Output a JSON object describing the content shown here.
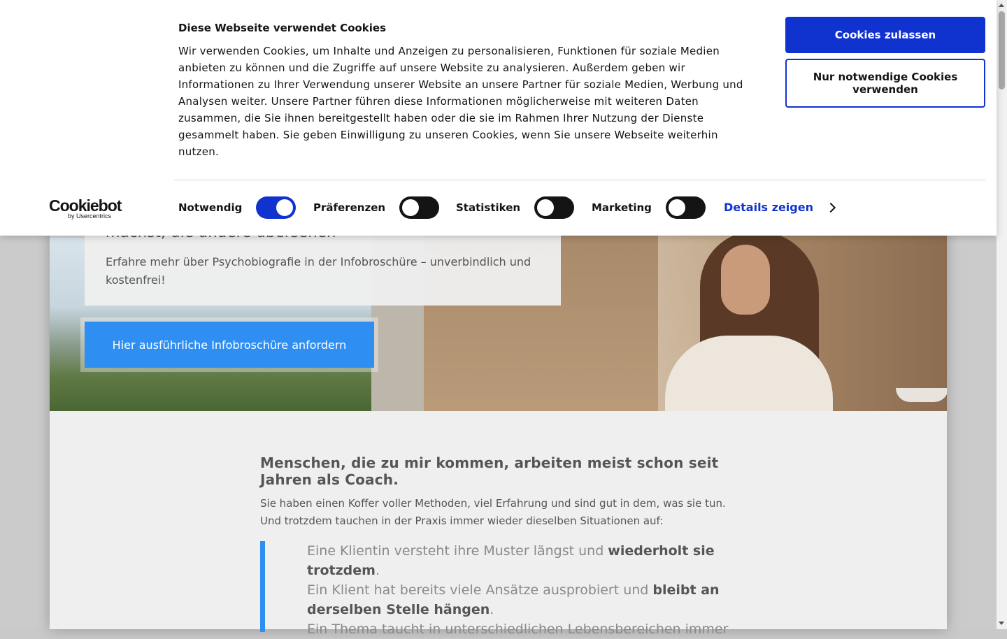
{
  "cookie_banner": {
    "title": "Diese Webseite verwendet Cookies",
    "text": "Wir verwenden Cookies, um Inhalte und Anzeigen zu personalisieren, Funktionen für soziale Medien anbieten zu können und die Zugriffe auf unsere Website zu analysieren. Außerdem geben wir Informationen zu Ihrer Verwendung unserer Website an unsere Partner für soziale Medien, Werbung und Analysen weiter. Unsere Partner führen diese Informationen möglicherweise mit weiteren Daten zusammen, die Sie ihnen bereitgestellt haben oder die sie im Rahmen Ihrer Nutzung der Dienste gesammelt haben. Sie geben Einwilligung zu unseren Cookies, wenn Sie unsere Webseite weiterhin nutzen.",
    "allow_button": "Cookies zulassen",
    "necessary_button": "Nur notwendige Cookies verwenden",
    "logo": {
      "main": "Cookiebot",
      "sub": "by Usercentrics"
    },
    "toggles": [
      {
        "label": "Notwendig",
        "on": true
      },
      {
        "label": "Präferenzen",
        "on": false
      },
      {
        "label": "Statistiken",
        "on": false
      },
      {
        "label": "Marketing",
        "on": false
      }
    ],
    "details_link": "Details zeigen",
    "accent_color": "#1032cf"
  },
  "hero": {
    "title_partial": "machst, die andere übersehen",
    "subtitle": "Erfahre mehr über Psychobiografie in der Infobroschüre – unverbindlich und kostenfrei!",
    "cta": "Hier ausführliche Infobroschüre anfordern",
    "cta_color": "#2f8ef2"
  },
  "section": {
    "title": "Menschen, die zu mir kommen, arbeiten meist schon seit Jahren als Coach.",
    "text": "Sie haben einen Koffer voller Methoden, viel Erfahrung und sind gut in dem, was sie tun. Und trotzdem tauchen in der Praxis immer wieder dieselben Situationen auf:",
    "quotes": [
      {
        "plain": "Eine Klientin versteht ihre Muster längst und ",
        "bold": "wiederholt sie trotzdem",
        "end": "."
      },
      {
        "plain": "Ein Klient hat bereits viele Ansätze ausprobiert und ",
        "bold": "bleibt an derselben Stelle hängen",
        "end": "."
      },
      {
        "plain": "Ein Thema taucht in unterschiedlichen Lebensbereichen immer",
        "bold": "",
        "end": ""
      }
    ]
  }
}
